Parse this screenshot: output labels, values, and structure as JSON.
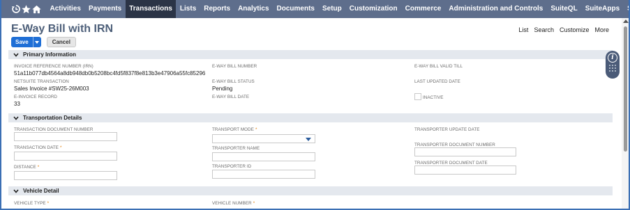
{
  "nav": {
    "items": [
      "Activities",
      "Payments",
      "Transactions",
      "Lists",
      "Reports",
      "Analytics",
      "Documents",
      "Setup",
      "Customization",
      "Commerce",
      "Administration and Controls",
      "SuiteQL",
      "SuiteApps",
      "Support"
    ],
    "active": "Transactions"
  },
  "page": {
    "title": "E-Way Bill with IRN"
  },
  "header_links": {
    "list": "List",
    "search": "Search",
    "customize": "Customize",
    "more": "More"
  },
  "buttons": {
    "save": "Save",
    "cancel": "Cancel"
  },
  "sections": {
    "primary": "Primary Information",
    "transport": "Transportation Details",
    "vehicle": "Vehicle Detail"
  },
  "primary": {
    "irn_label": "INVOICE REFERENCE NUMBER (IRN)",
    "irn_value": "51a11b077db4564a8db948db0b5208bc4fd5f837f8e813b3e47906a55fc85296",
    "netsuite_label": "NETSUITE TRANSACTION",
    "netsuite_value": "Sales Invoice #SW25-26M003",
    "einvoice_label": "E-INVOICE RECORD",
    "einvoice_value": "33",
    "ewb_number_label": "E-WAY BILL NUMBER",
    "ewb_status_label": "E-WAY BILL STATUS",
    "ewb_status_value": "Pending",
    "ewb_date_label": "E-WAY BILL DATE",
    "ewb_valid_label": "E-WAY BILL VALID TILL",
    "last_updated_label": "LAST UPDATED DATE",
    "inactive_label": "INACTIVE"
  },
  "transport": {
    "doc_number_label": "TRANSACTION DOCUMENT NUMBER",
    "date_label": "TRANSACTION DATE",
    "distance_label": "DISTANCE",
    "mode_label": "TRANSPORT MODE",
    "name_label": "TRANSPORTER NAME",
    "id_label": "TRANSPORTER ID",
    "update_date_label": "TRANSPORTER UPDATE DATE",
    "transporter_doc_number_label": "TRANSPORTER DOCUMENT NUMBER",
    "transporter_doc_date_label": "TRANSPORTER DOCUMENT DATE"
  },
  "vehicle": {
    "type_label": "VEHICLE TYPE",
    "number_label": "VEHICLE NUMBER"
  },
  "required_mark": "*",
  "colors": {
    "nav_bg": "#5e6e8c",
    "nav_active": "#2b3446",
    "save_blue": "#1f6fd6",
    "title": "#4d5f79",
    "section_bg": "#e4e8ee"
  }
}
